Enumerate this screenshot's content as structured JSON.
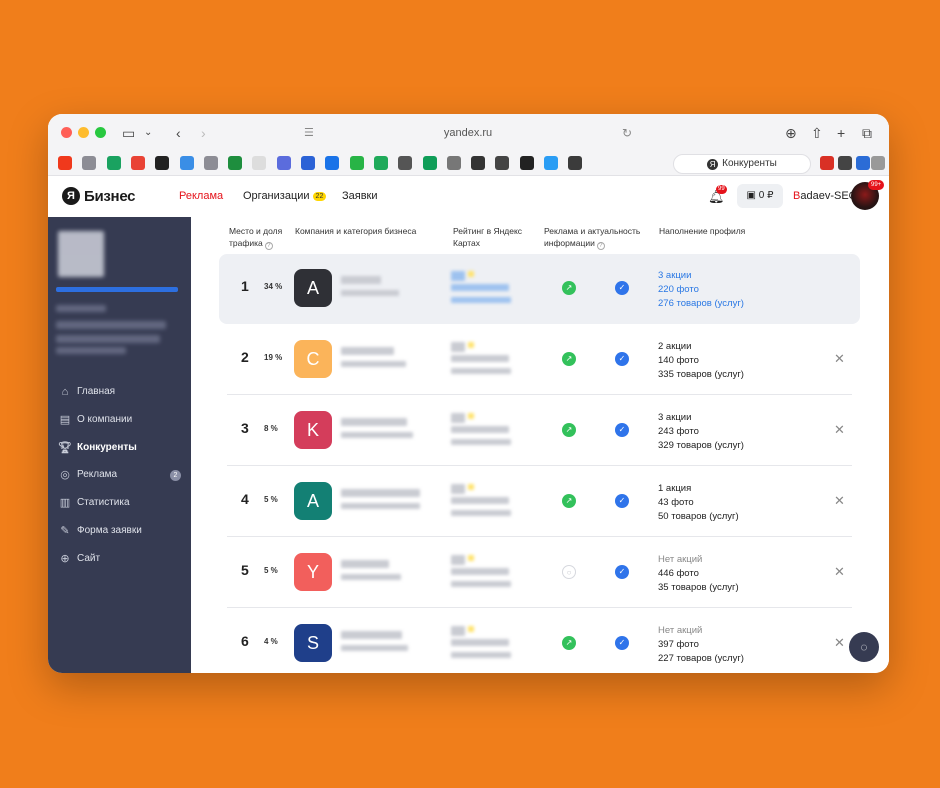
{
  "browser": {
    "url": "yandex.ru",
    "active_tab": "Конкуренты"
  },
  "header": {
    "brand": "Бизнес",
    "logo_letter": "Я",
    "nav": [
      {
        "label": "Реклама",
        "active": true
      },
      {
        "label": "Организации",
        "count": "22"
      },
      {
        "label": "Заявки"
      }
    ],
    "notifications": "99",
    "balance": "0 ₽",
    "user_first": "B",
    "user_rest": "adaev-SEO",
    "avatar_badge": "99+"
  },
  "sidebar": {
    "menu": [
      {
        "label": "Главная",
        "icon": "home-icon"
      },
      {
        "label": "О компании",
        "icon": "document-icon"
      },
      {
        "label": "Конкуренты",
        "icon": "trophy-icon",
        "active": true
      },
      {
        "label": "Реклама",
        "icon": "ad-icon",
        "badge": "2"
      },
      {
        "label": "Статистика",
        "icon": "chart-icon"
      },
      {
        "label": "Форма заявки",
        "icon": "form-icon"
      },
      {
        "label": "Сайт",
        "icon": "globe-icon"
      }
    ]
  },
  "table": {
    "headers": {
      "place": "Место и доля трафика",
      "company": "Компания и категория бизнеса",
      "rating": "Рейтинг в Яндекс Картах",
      "ads": "Реклама и актуальность информации",
      "profile": "Наполнение профиля"
    },
    "rows": [
      {
        "rank": "1",
        "share": "34 %",
        "letter": "A",
        "color": "#2f3036",
        "ads_active": true,
        "promo": "3 акции",
        "photos": "220 фото",
        "goods": "276 товаров (услуг)",
        "link": true
      },
      {
        "rank": "2",
        "share": "19 %",
        "letter": "C",
        "color": "#fbb45a",
        "ads_active": true,
        "promo": "2 акции",
        "photos": "140 фото",
        "goods": "335 товаров (услуг)"
      },
      {
        "rank": "3",
        "share": "8 %",
        "letter": "K",
        "color": "#d43d5b",
        "ads_active": true,
        "promo": "3 акции",
        "photos": "243 фото",
        "goods": "329 товаров (услуг)"
      },
      {
        "rank": "4",
        "share": "5 %",
        "letter": "A",
        "color": "#138074",
        "ads_active": true,
        "promo": "1 акция",
        "photos": "43 фото",
        "goods": "50 товаров (услуг)"
      },
      {
        "rank": "5",
        "share": "5 %",
        "letter": "Y",
        "color": "#f25f5c",
        "ads_active": false,
        "promo": "Нет акций",
        "photos": "446 фото",
        "goods": "35 товаров (услуг)",
        "no_promo": true
      },
      {
        "rank": "6",
        "share": "4 %",
        "letter": "S",
        "color": "#1f3f8a",
        "ads_active": true,
        "promo": "Нет акций",
        "photos": "397 фото",
        "goods": "227 товаров (услуг)",
        "no_promo": true
      }
    ]
  }
}
